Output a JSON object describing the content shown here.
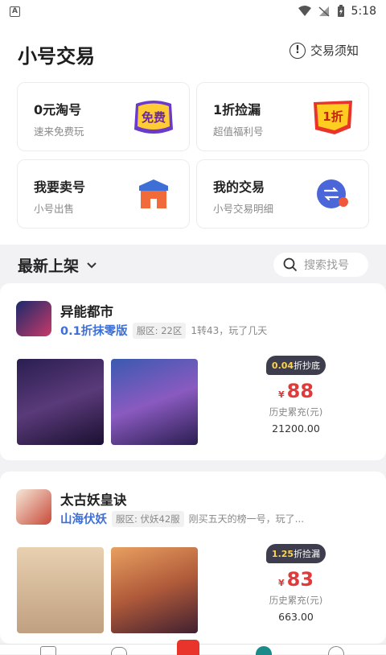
{
  "status_bar": {
    "time": "5:18"
  },
  "header": {
    "title": "小号交易",
    "notice_label": "交易须知"
  },
  "cards": [
    {
      "title": "0元淘号",
      "subtitle": "速来免费玩",
      "icon": "free-badge-icon",
      "badge_text": "免费"
    },
    {
      "title": "1折捡漏",
      "subtitle": "超值福利号",
      "icon": "discount-badge-icon",
      "badge_text": "1折"
    },
    {
      "title": "我要卖号",
      "subtitle": "小号出售",
      "icon": "shop-icon"
    },
    {
      "title": "我的交易",
      "subtitle": "小号交易明细",
      "icon": "swap-icon"
    }
  ],
  "section": {
    "title": "最新上架",
    "search_placeholder": "搜索找号"
  },
  "listings": [
    {
      "game_name": "异能都市",
      "server_name": "0.1折抹零版",
      "server_tag": "服区: 22区",
      "description": "1转43，玩了几天",
      "discount_num": "0.04",
      "discount_text": "折抄底",
      "currency": "¥",
      "price": "88",
      "history_label": "历史累充(元)",
      "history_value": "21200.00",
      "colors": {
        "shot1": "#3a2a6a",
        "shot2": "#5a3a8a"
      }
    },
    {
      "game_name": "太古妖皇诀",
      "server_name": "山海伏妖",
      "server_tag": "服区: 伏妖42服",
      "description": "刚买五天的榜一号，玩了...",
      "discount_num": "1.25",
      "discount_text": "折捡漏",
      "currency": "¥",
      "price": "83",
      "history_label": "历史累充(元)",
      "history_value": "663.00",
      "colors": {
        "shot1": "#c9a27a",
        "shot2": "#d08a4a"
      }
    }
  ],
  "theme": {
    "accent_blue": "#3d6fd6",
    "price_red": "#e03a3a"
  }
}
